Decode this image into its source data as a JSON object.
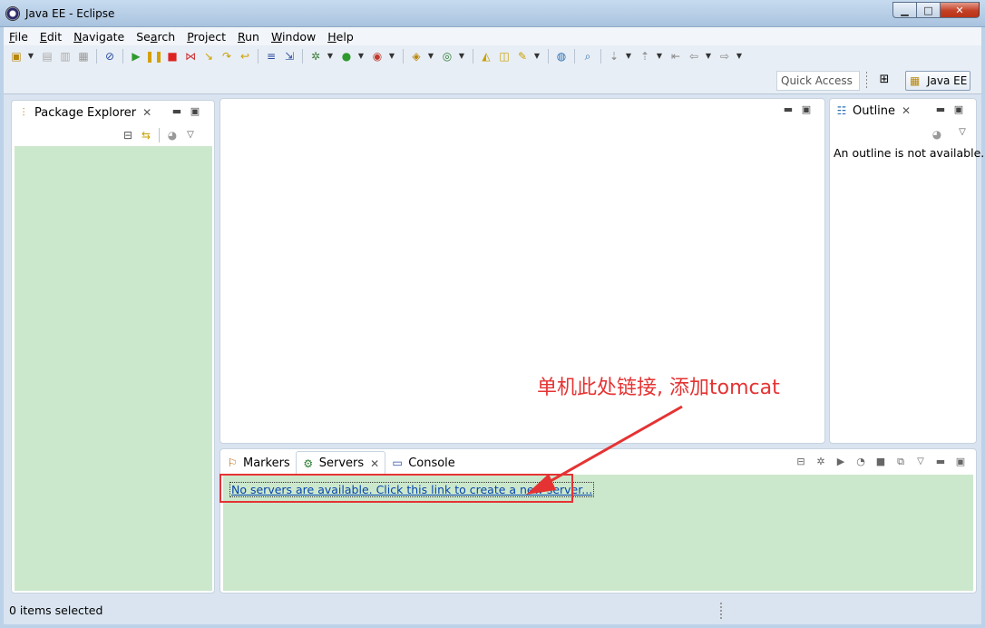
{
  "window": {
    "title": "Java EE - Eclipse",
    "minimize_label": "▁",
    "maximize_label": "□",
    "close_label": "✕"
  },
  "menu": [
    {
      "mn": "F",
      "rest": "ile"
    },
    {
      "mn": "E",
      "rest": "dit"
    },
    {
      "mn": "N",
      "rest": "avigate"
    },
    {
      "pre": "Se",
      "mn": "a",
      "rest": "rch"
    },
    {
      "mn": "P",
      "rest": "roject"
    },
    {
      "mn": "R",
      "rest": "un"
    },
    {
      "mn": "W",
      "rest": "indow"
    },
    {
      "mn": "H",
      "rest": "elp"
    }
  ],
  "toolbar": {
    "quick_access_placeholder": "Quick Access",
    "perspective_label": "Java EE"
  },
  "package_explorer": {
    "title": "Package Explorer",
    "close_glyph": "✕"
  },
  "outline": {
    "title": "Outline",
    "message": "An outline is not available."
  },
  "bottom_tabs": [
    {
      "label": "Markers"
    },
    {
      "label": "Servers"
    },
    {
      "label": "Console"
    }
  ],
  "servers": {
    "link_text": "No servers are available. Click this link to create a new server..."
  },
  "status": {
    "text": "0 items selected"
  },
  "annotation": {
    "text": "单机此处链接, 添加tomcat",
    "color": "#e53333"
  },
  "colors": {
    "view_background": "#cce8cc",
    "link": "#0645ad"
  }
}
